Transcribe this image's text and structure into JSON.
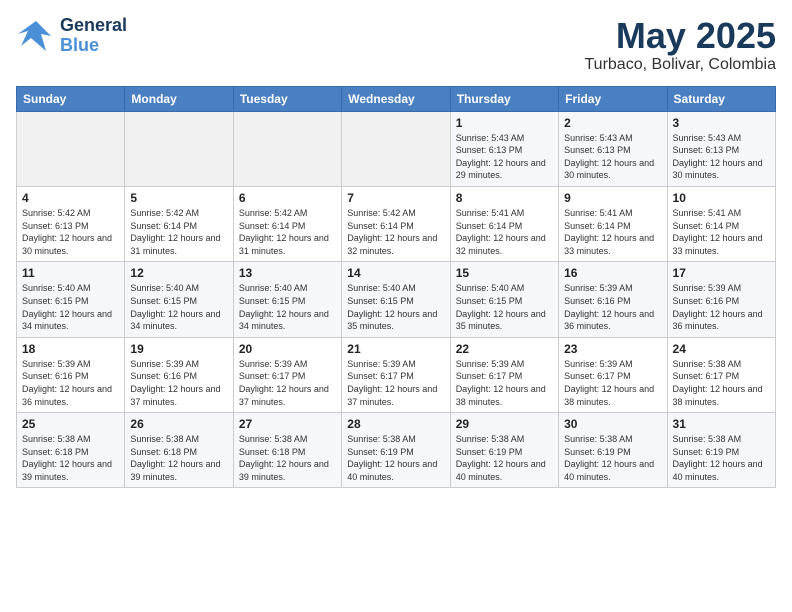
{
  "header": {
    "logo_general": "General",
    "logo_blue": "Blue",
    "title": "May 2025",
    "subtitle": "Turbaco, Bolivar, Colombia"
  },
  "calendar": {
    "days_of_week": [
      "Sunday",
      "Monday",
      "Tuesday",
      "Wednesday",
      "Thursday",
      "Friday",
      "Saturday"
    ],
    "weeks": [
      [
        {
          "day": "",
          "info": ""
        },
        {
          "day": "",
          "info": ""
        },
        {
          "day": "",
          "info": ""
        },
        {
          "day": "",
          "info": ""
        },
        {
          "day": "1",
          "info": "Sunrise: 5:43 AM\nSunset: 6:13 PM\nDaylight: 12 hours\nand 29 minutes."
        },
        {
          "day": "2",
          "info": "Sunrise: 5:43 AM\nSunset: 6:13 PM\nDaylight: 12 hours\nand 30 minutes."
        },
        {
          "day": "3",
          "info": "Sunrise: 5:43 AM\nSunset: 6:13 PM\nDaylight: 12 hours\nand 30 minutes."
        }
      ],
      [
        {
          "day": "4",
          "info": "Sunrise: 5:42 AM\nSunset: 6:13 PM\nDaylight: 12 hours\nand 30 minutes."
        },
        {
          "day": "5",
          "info": "Sunrise: 5:42 AM\nSunset: 6:14 PM\nDaylight: 12 hours\nand 31 minutes."
        },
        {
          "day": "6",
          "info": "Sunrise: 5:42 AM\nSunset: 6:14 PM\nDaylight: 12 hours\nand 31 minutes."
        },
        {
          "day": "7",
          "info": "Sunrise: 5:42 AM\nSunset: 6:14 PM\nDaylight: 12 hours\nand 32 minutes."
        },
        {
          "day": "8",
          "info": "Sunrise: 5:41 AM\nSunset: 6:14 PM\nDaylight: 12 hours\nand 32 minutes."
        },
        {
          "day": "9",
          "info": "Sunrise: 5:41 AM\nSunset: 6:14 PM\nDaylight: 12 hours\nand 33 minutes."
        },
        {
          "day": "10",
          "info": "Sunrise: 5:41 AM\nSunset: 6:14 PM\nDaylight: 12 hours\nand 33 minutes."
        }
      ],
      [
        {
          "day": "11",
          "info": "Sunrise: 5:40 AM\nSunset: 6:15 PM\nDaylight: 12 hours\nand 34 minutes."
        },
        {
          "day": "12",
          "info": "Sunrise: 5:40 AM\nSunset: 6:15 PM\nDaylight: 12 hours\nand 34 minutes."
        },
        {
          "day": "13",
          "info": "Sunrise: 5:40 AM\nSunset: 6:15 PM\nDaylight: 12 hours\nand 34 minutes."
        },
        {
          "day": "14",
          "info": "Sunrise: 5:40 AM\nSunset: 6:15 PM\nDaylight: 12 hours\nand 35 minutes."
        },
        {
          "day": "15",
          "info": "Sunrise: 5:40 AM\nSunset: 6:15 PM\nDaylight: 12 hours\nand 35 minutes."
        },
        {
          "day": "16",
          "info": "Sunrise: 5:39 AM\nSunset: 6:16 PM\nDaylight: 12 hours\nand 36 minutes."
        },
        {
          "day": "17",
          "info": "Sunrise: 5:39 AM\nSunset: 6:16 PM\nDaylight: 12 hours\nand 36 minutes."
        }
      ],
      [
        {
          "day": "18",
          "info": "Sunrise: 5:39 AM\nSunset: 6:16 PM\nDaylight: 12 hours\nand 36 minutes."
        },
        {
          "day": "19",
          "info": "Sunrise: 5:39 AM\nSunset: 6:16 PM\nDaylight: 12 hours\nand 37 minutes."
        },
        {
          "day": "20",
          "info": "Sunrise: 5:39 AM\nSunset: 6:17 PM\nDaylight: 12 hours\nand 37 minutes."
        },
        {
          "day": "21",
          "info": "Sunrise: 5:39 AM\nSunset: 6:17 PM\nDaylight: 12 hours\nand 37 minutes."
        },
        {
          "day": "22",
          "info": "Sunrise: 5:39 AM\nSunset: 6:17 PM\nDaylight: 12 hours\nand 38 minutes."
        },
        {
          "day": "23",
          "info": "Sunrise: 5:39 AM\nSunset: 6:17 PM\nDaylight: 12 hours\nand 38 minutes."
        },
        {
          "day": "24",
          "info": "Sunrise: 5:38 AM\nSunset: 6:17 PM\nDaylight: 12 hours\nand 38 minutes."
        }
      ],
      [
        {
          "day": "25",
          "info": "Sunrise: 5:38 AM\nSunset: 6:18 PM\nDaylight: 12 hours\nand 39 minutes."
        },
        {
          "day": "26",
          "info": "Sunrise: 5:38 AM\nSunset: 6:18 PM\nDaylight: 12 hours\nand 39 minutes."
        },
        {
          "day": "27",
          "info": "Sunrise: 5:38 AM\nSunset: 6:18 PM\nDaylight: 12 hours\nand 39 minutes."
        },
        {
          "day": "28",
          "info": "Sunrise: 5:38 AM\nSunset: 6:19 PM\nDaylight: 12 hours\nand 40 minutes."
        },
        {
          "day": "29",
          "info": "Sunrise: 5:38 AM\nSunset: 6:19 PM\nDaylight: 12 hours\nand 40 minutes."
        },
        {
          "day": "30",
          "info": "Sunrise: 5:38 AM\nSunset: 6:19 PM\nDaylight: 12 hours\nand 40 minutes."
        },
        {
          "day": "31",
          "info": "Sunrise: 5:38 AM\nSunset: 6:19 PM\nDaylight: 12 hours\nand 40 minutes."
        }
      ]
    ]
  }
}
